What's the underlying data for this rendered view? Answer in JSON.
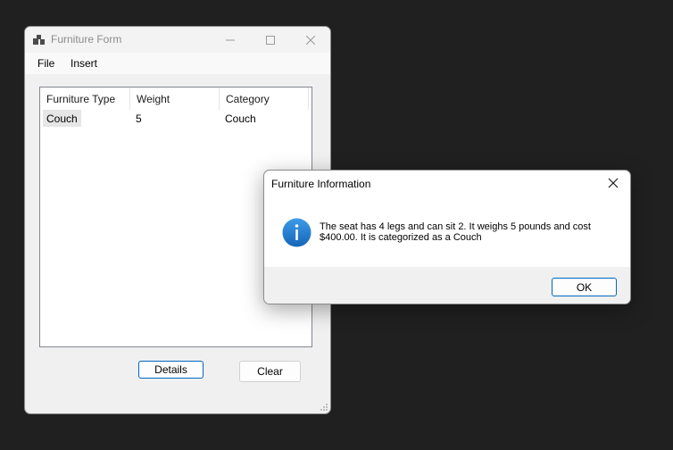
{
  "form_window": {
    "title": "Furniture Form",
    "menu": [
      "File",
      "Insert"
    ],
    "list": {
      "columns": [
        "Furniture Type",
        "Weight",
        "Category"
      ],
      "rows": [
        {
          "type": "Couch",
          "weight": "5",
          "category": "Couch"
        }
      ]
    },
    "buttons": {
      "details": "Details",
      "clear": "Clear"
    },
    "icons": {
      "app": "app-icon",
      "minimize": "minimize-icon",
      "maximize": "maximize-icon",
      "close": "close-icon",
      "grip": "resize-grip-icon"
    }
  },
  "dialog": {
    "title": "Furniture Information",
    "message": "The seat has 4 legs and can sit 2. It weighs 5 pounds and cost $400.00. It is categorized as a Couch",
    "ok_label": "OK",
    "icons": {
      "info": "info-icon",
      "close": "close-icon"
    }
  },
  "colors": {
    "desktop": "#202020",
    "accent": "#0067c0",
    "info_icon": "#1e84d8"
  }
}
